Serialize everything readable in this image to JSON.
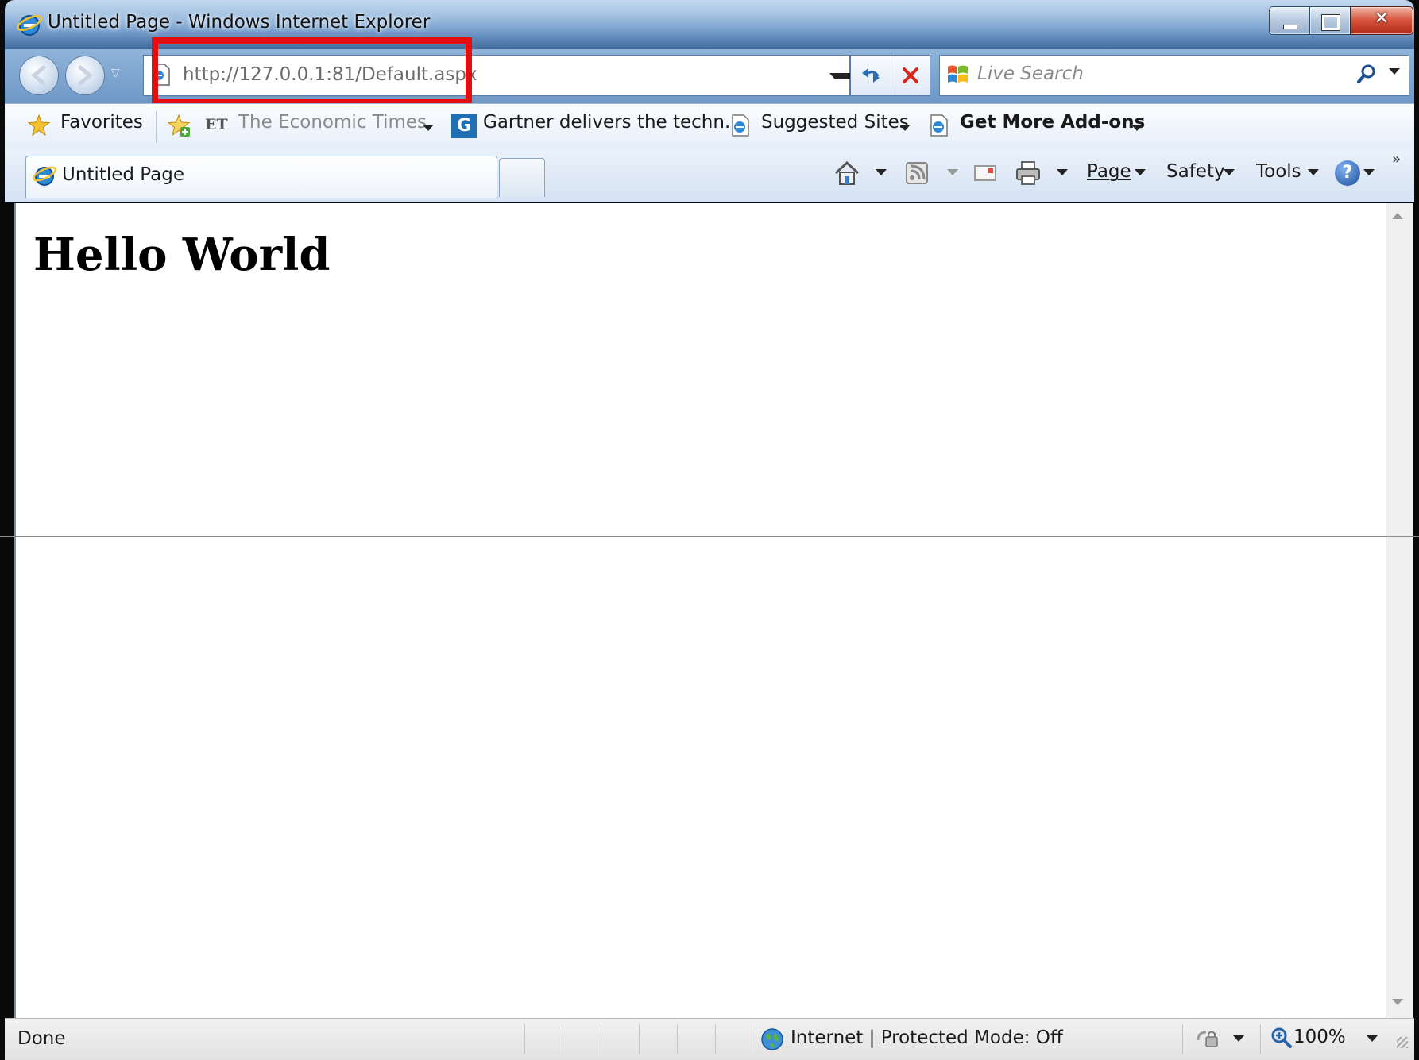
{
  "window": {
    "title": "Untitled Page - Windows Internet Explorer"
  },
  "navigation": {
    "address_url": "http://127.0.0.1:81/Default.aspx",
    "search_placeholder": "Live Search"
  },
  "favorites_bar": {
    "favorites_label": "Favorites",
    "items": [
      {
        "label": "The Economic Times",
        "icon_text": "ET"
      },
      {
        "label": "Gartner delivers the techn...",
        "icon_text": "G"
      },
      {
        "label": "Suggested Sites"
      },
      {
        "label": "Get More Add-ons"
      }
    ]
  },
  "tabs": [
    {
      "label": "Untitled Page"
    }
  ],
  "command_bar": {
    "page_label": "Page",
    "safety_label": "Safety",
    "tools_label": "Tools",
    "help_glyph": "?",
    "more_glyph": "»"
  },
  "content": {
    "heading": "Hello World"
  },
  "status_bar": {
    "status": "Done",
    "zone": "Internet | Protected Mode: Off",
    "zoom": "100%"
  },
  "colors": {
    "highlight_box": "#e50e0e",
    "title_gradient_top": "#c4d9ef",
    "close_button": "#d6523a"
  }
}
